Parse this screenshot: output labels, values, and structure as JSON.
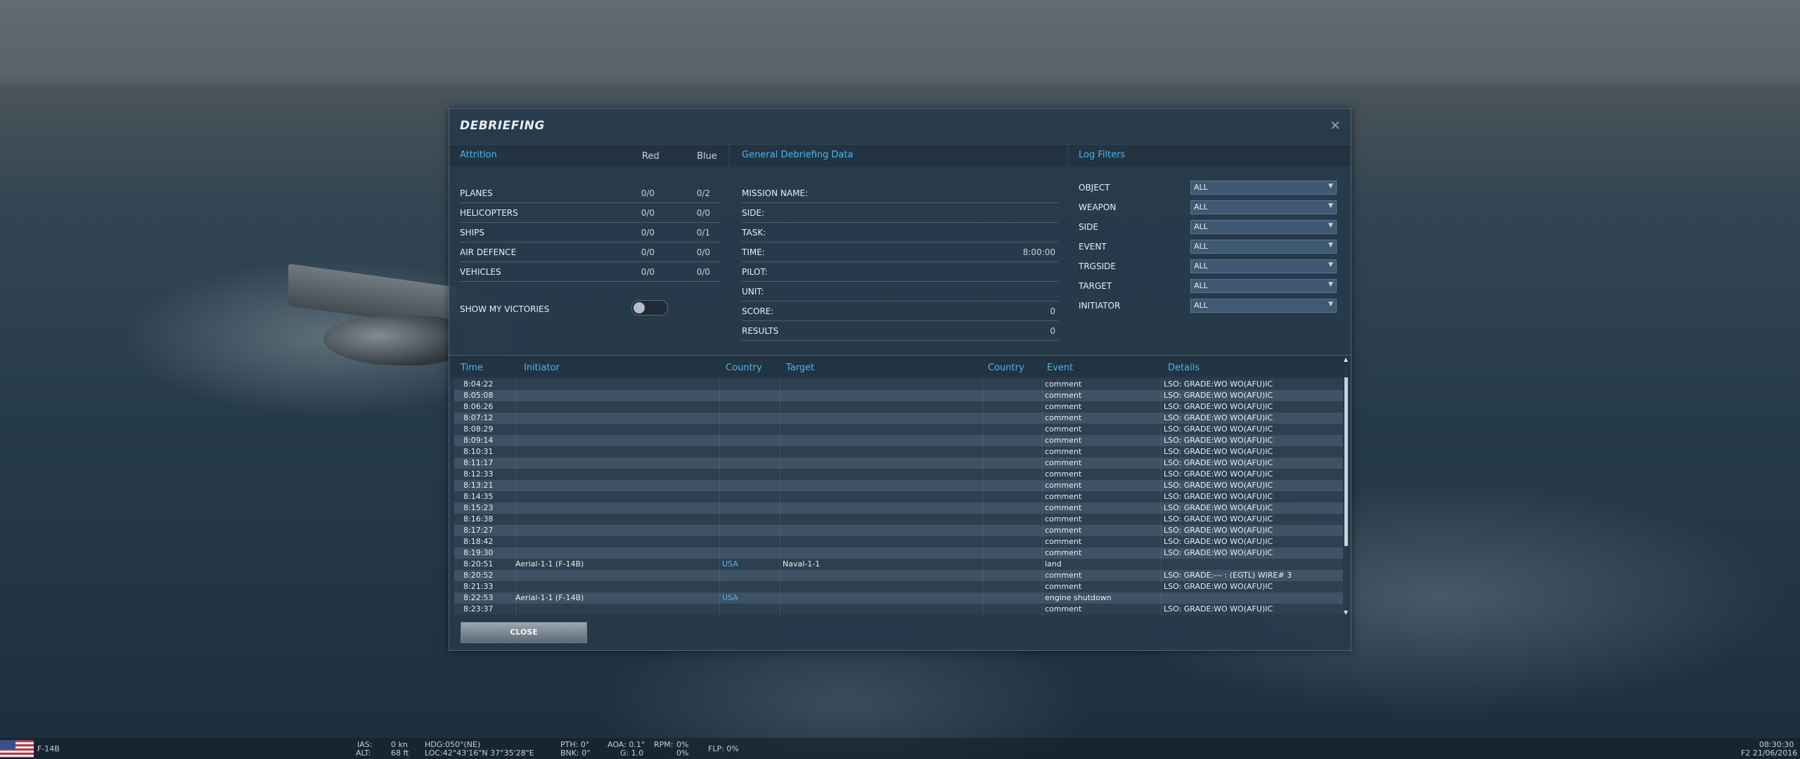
{
  "dialog": {
    "title": "DEBRIEFING",
    "close_glyph": "×",
    "close_button": "CLOSE"
  },
  "attrition": {
    "title": "Attrition",
    "red_label": "Red",
    "blue_label": "Blue",
    "rows": [
      {
        "label": "PLANES",
        "red": "0/0",
        "blue": "0/2"
      },
      {
        "label": "HELICOPTERS",
        "red": "0/0",
        "blue": "0/0"
      },
      {
        "label": "SHIPS",
        "red": "0/0",
        "blue": "0/1"
      },
      {
        "label": "AIR DEFENCE",
        "red": "0/0",
        "blue": "0/0"
      },
      {
        "label": "VEHICLES",
        "red": "0/0",
        "blue": "0/0"
      }
    ],
    "show_victories_label": "SHOW MY VICTORIES",
    "show_victories_on": false
  },
  "general": {
    "title": "General Debriefing Data",
    "rows": [
      {
        "label": "MISSION NAME:",
        "value": ""
      },
      {
        "label": "SIDE:",
        "value": ""
      },
      {
        "label": "TASK:",
        "value": ""
      },
      {
        "label": "TIME:",
        "value": "8:00:00"
      },
      {
        "label": "PILOT:",
        "value": ""
      },
      {
        "label": "UNIT:",
        "value": ""
      },
      {
        "label": "SCORE:",
        "value": "0"
      },
      {
        "label": "RESULTS",
        "value": "0"
      }
    ]
  },
  "filters": {
    "title": "Log Filters",
    "items": [
      {
        "label": "OBJECT",
        "value": "ALL"
      },
      {
        "label": "WEAPON",
        "value": "ALL"
      },
      {
        "label": "SIDE",
        "value": "ALL"
      },
      {
        "label": "EVENT",
        "value": "ALL"
      },
      {
        "label": "TRGSIDE",
        "value": "ALL"
      },
      {
        "label": "TARGET",
        "value": "ALL"
      },
      {
        "label": "INITIATOR",
        "value": "ALL"
      }
    ]
  },
  "log": {
    "columns": {
      "time": "Time",
      "initiator": "Initiator",
      "country": "Country",
      "target": "Target",
      "country2": "Country",
      "event": "Event",
      "details": "Details"
    },
    "rows": [
      {
        "time": "8:04:22",
        "initiator": "",
        "country": "",
        "target": "",
        "country2": "",
        "event": "comment",
        "details": "LSO: GRADE:WO  WO(AFU)IC"
      },
      {
        "time": "8:05:08",
        "initiator": "",
        "country": "",
        "target": "",
        "country2": "",
        "event": "comment",
        "details": "LSO: GRADE:WO  WO(AFU)IC"
      },
      {
        "time": "8:06:26",
        "initiator": "",
        "country": "",
        "target": "",
        "country2": "",
        "event": "comment",
        "details": "LSO: GRADE:WO  WO(AFU)IC"
      },
      {
        "time": "8:07:12",
        "initiator": "",
        "country": "",
        "target": "",
        "country2": "",
        "event": "comment",
        "details": "LSO: GRADE:WO  WO(AFU)IC"
      },
      {
        "time": "8:08:29",
        "initiator": "",
        "country": "",
        "target": "",
        "country2": "",
        "event": "comment",
        "details": "LSO: GRADE:WO  WO(AFU)IC"
      },
      {
        "time": "8:09:14",
        "initiator": "",
        "country": "",
        "target": "",
        "country2": "",
        "event": "comment",
        "details": "LSO: GRADE:WO  WO(AFU)IC"
      },
      {
        "time": "8:10:31",
        "initiator": "",
        "country": "",
        "target": "",
        "country2": "",
        "event": "comment",
        "details": "LSO: GRADE:WO  WO(AFU)IC"
      },
      {
        "time": "8:11:17",
        "initiator": "",
        "country": "",
        "target": "",
        "country2": "",
        "event": "comment",
        "details": "LSO: GRADE:WO  WO(AFU)IC"
      },
      {
        "time": "8:12:33",
        "initiator": "",
        "country": "",
        "target": "",
        "country2": "",
        "event": "comment",
        "details": "LSO: GRADE:WO  WO(AFU)IC"
      },
      {
        "time": "8:13:21",
        "initiator": "",
        "country": "",
        "target": "",
        "country2": "",
        "event": "comment",
        "details": "LSO: GRADE:WO  WO(AFU)IC"
      },
      {
        "time": "8:14:35",
        "initiator": "",
        "country": "",
        "target": "",
        "country2": "",
        "event": "comment",
        "details": "LSO: GRADE:WO  WO(AFU)IC"
      },
      {
        "time": "8:15:23",
        "initiator": "",
        "country": "",
        "target": "",
        "country2": "",
        "event": "comment",
        "details": "LSO: GRADE:WO  WO(AFU)IC"
      },
      {
        "time": "8:16:38",
        "initiator": "",
        "country": "",
        "target": "",
        "country2": "",
        "event": "comment",
        "details": "LSO: GRADE:WO  WO(AFU)IC"
      },
      {
        "time": "8:17:27",
        "initiator": "",
        "country": "",
        "target": "",
        "country2": "",
        "event": "comment",
        "details": "LSO: GRADE:WO  WO(AFU)IC"
      },
      {
        "time": "8:18:42",
        "initiator": "",
        "country": "",
        "target": "",
        "country2": "",
        "event": "comment",
        "details": "LSO: GRADE:WO  WO(AFU)IC"
      },
      {
        "time": "8:19:30",
        "initiator": "",
        "country": "",
        "target": "",
        "country2": "",
        "event": "comment",
        "details": "LSO: GRADE:WO  WO(AFU)IC"
      },
      {
        "time": "8:20:51",
        "initiator": "Aerial-1-1 (F-14B)",
        "country": "USA",
        "target": "Naval-1-1",
        "country2": "",
        "event": "land",
        "details": ""
      },
      {
        "time": "8:20:52",
        "initiator": "",
        "country": "",
        "target": "",
        "country2": "",
        "event": "comment",
        "details": "LSO: GRADE:--- : (EGTL)  WIRE# 3"
      },
      {
        "time": "8:21:33",
        "initiator": "",
        "country": "",
        "target": "",
        "country2": "",
        "event": "comment",
        "details": "LSO: GRADE:WO  WO(AFU)IC"
      },
      {
        "time": "8:22:53",
        "initiator": "Aerial-1-1 (F-14B)",
        "country": "USA",
        "target": "",
        "country2": "",
        "event": "engine shutdown",
        "details": ""
      },
      {
        "time": "8:23:37",
        "initiator": "",
        "country": "",
        "target": "",
        "country2": "",
        "event": "comment",
        "details": "LSO: GRADE:WO  WO(AFU)IC"
      }
    ]
  },
  "hud": {
    "aircraft": "F-14B",
    "ias_label": "IAS:",
    "ias_value": "0 kn",
    "alt_label": "ALT:",
    "alt_value": "68 ft",
    "hdg": "HDG:050°(NE)",
    "loc": "LOC:42°43'16\"N 37°35'28\"E",
    "pth": "PTH: 0°",
    "bnk": "BNK: 0°",
    "aoa": "AOA: 0.1°",
    "g": "G: 1.0",
    "rpm_label": "RPM:",
    "rpm_value1": "0%",
    "rpm_value2": "0%",
    "flp": "FLP: 0%",
    "clock": "08:30:30",
    "date": "F2 21/06/2016"
  },
  "colors": {
    "accent": "#4ab8ea",
    "panel": "#263a4a"
  }
}
